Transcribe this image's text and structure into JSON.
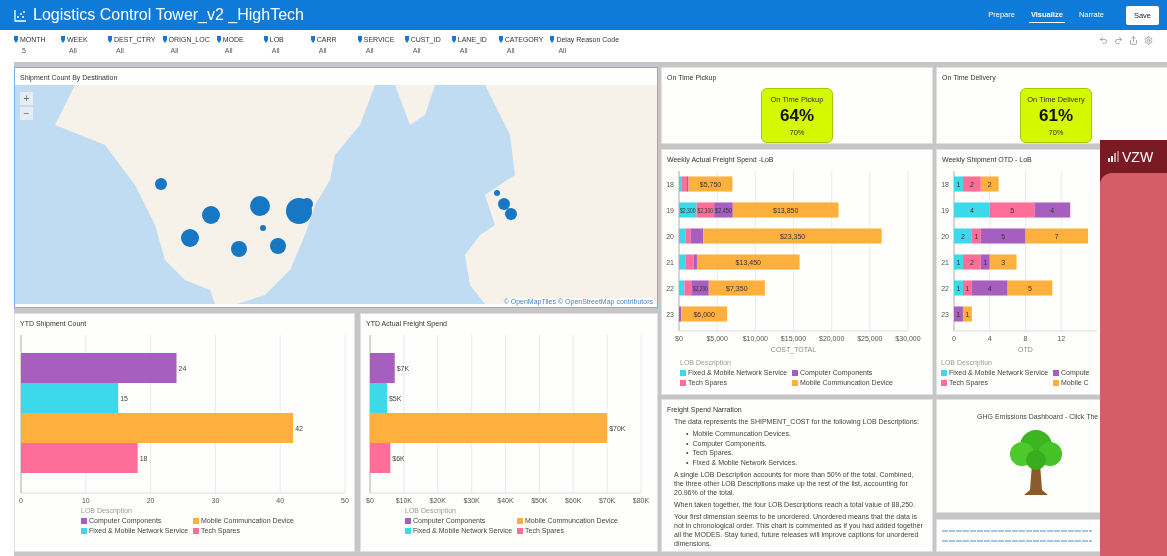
{
  "header": {
    "title": "Logistics Control Tower_v2 _HighTech",
    "tabs": [
      {
        "label": "Prepare",
        "selected": false
      },
      {
        "label": "Visualize",
        "selected": true
      },
      {
        "label": "Narrate",
        "selected": false
      }
    ],
    "save": "Save"
  },
  "filters": [
    {
      "label": "MONTH",
      "value": "5"
    },
    {
      "label": "WEEK",
      "value": "All"
    },
    {
      "label": "DEST_CTRY",
      "value": "All"
    },
    {
      "label": "ORIGN_LOC",
      "value": "All"
    },
    {
      "label": "MODE",
      "value": "All"
    },
    {
      "label": "LOB",
      "value": "All"
    },
    {
      "label": "CARR",
      "value": "All"
    },
    {
      "label": "SERVICE",
      "value": "All"
    },
    {
      "label": "CUST_ID",
      "value": "All"
    },
    {
      "label": "LANE_ID",
      "value": "All"
    },
    {
      "label": "CATEGORY",
      "value": "All"
    },
    {
      "label": "Delay Reason Code",
      "value": "All"
    }
  ],
  "map": {
    "title": "Shipment Count By Destination",
    "zoom_in": "+",
    "zoom_out": "−",
    "attribution": "© OpenMapTiles  © OpenStreetMap contributors"
  },
  "ytd_count": {
    "title": "YTD Shipment Count",
    "legend_title": "LOB Description",
    "chart_data": {
      "type": "bar",
      "orientation": "horizontal",
      "grid": true,
      "xlim": [
        0,
        50
      ],
      "xticks": [
        0,
        10,
        20,
        30,
        40,
        50
      ],
      "value_labels": [
        "24",
        "15",
        "42",
        "18"
      ],
      "series": [
        {
          "name": "Computer Components",
          "color": "#a65fbf",
          "values": [
            24,
            null,
            null,
            null
          ]
        },
        {
          "name": "Fixed & Mobile Network Service",
          "color": "#3bd9ea",
          "values": [
            null,
            15,
            null,
            null
          ]
        },
        {
          "name": "Mobile Communcation Device",
          "color": "#fdb03d",
          "values": [
            null,
            null,
            42,
            null
          ]
        },
        {
          "name": "Tech Spares",
          "color": "#fe6e98",
          "values": [
            null,
            null,
            null,
            18
          ]
        }
      ]
    }
  },
  "ytd_spend": {
    "title": "YTD Actual Freight Spend",
    "legend_title": "LOB Description",
    "chart_data": {
      "type": "bar",
      "orientation": "horizontal",
      "grid": true,
      "xlim": [
        0,
        80
      ],
      "xticks": [
        {
          "value": 0,
          "label": "$0"
        },
        {
          "value": 10,
          "label": "$10K"
        },
        {
          "value": 20,
          "label": "$20K"
        },
        {
          "value": 30,
          "label": "$30K"
        },
        {
          "value": 40,
          "label": "$40K"
        },
        {
          "value": 50,
          "label": "$50K"
        },
        {
          "value": 60,
          "label": "$60K"
        },
        {
          "value": 70,
          "label": "$70K"
        },
        {
          "value": 80,
          "label": "$80K"
        }
      ],
      "value_labels": [
        "$7K",
        "$5K",
        "$70K",
        "$6K"
      ],
      "series": [
        {
          "name": "Computer Components",
          "color": "#a65fbf",
          "values": [
            7.3,
            null,
            null,
            null
          ]
        },
        {
          "name": "Fixed & Mobile Network Service",
          "color": "#3bd9ea",
          "values": [
            null,
            5,
            null,
            null
          ]
        },
        {
          "name": "Mobile Communcation Device",
          "color": "#fdb03d",
          "values": [
            null,
            null,
            70,
            null
          ]
        },
        {
          "name": "Tech Spares",
          "color": "#fe6e98",
          "values": [
            null,
            null,
            null,
            6
          ]
        }
      ]
    }
  },
  "kpis": [
    {
      "panel_title": "On Time Pickup",
      "title": "On Time Pickup",
      "value": "64%",
      "target": "70%"
    },
    {
      "panel_title": "On Time Delivery",
      "title": "On Time Delivery",
      "value": "61%",
      "target": "70%"
    }
  ],
  "weekly_spend": {
    "title": "Weekly Actual Freight Spend -LoB",
    "legend_title": "LOB Description",
    "chart_data": {
      "type": "bar",
      "orientation": "horizontal",
      "stacked": true,
      "grid": true,
      "xlabel": "COST_TOTAL",
      "categories": [
        "18",
        "19",
        "20",
        "21",
        "22",
        "23"
      ],
      "xlim": [
        0,
        30000
      ],
      "xticks": [
        {
          "value": 0,
          "label": "$0"
        },
        {
          "value": 5000,
          "label": "$5,000"
        },
        {
          "value": 10000,
          "label": "$10,000"
        },
        {
          "value": 15000,
          "label": "$15,000"
        },
        {
          "value": 20000,
          "label": "$20,000"
        },
        {
          "value": 25000,
          "label": "$25,000"
        },
        {
          "value": 30000,
          "label": "$30,000"
        }
      ],
      "value_labels": [
        [
          null,
          "$2,300",
          null,
          null,
          null,
          null
        ],
        [
          null,
          "$2,300",
          null,
          null,
          null,
          null
        ],
        [
          null,
          "$2,450",
          null,
          null,
          "$2,200",
          null
        ],
        [
          "$5,750",
          "$13,850",
          "$23,350",
          "$13,450",
          "$7,350",
          "$6,000"
        ]
      ],
      "series": [
        {
          "name": "Fixed & Mobile Network Service",
          "color": "#3bd9ea",
          "values": [
            400,
            2300,
            850,
            900,
            700,
            null
          ]
        },
        {
          "name": "Tech Spares",
          "color": "#fe6e98",
          "values": [
            650,
            2300,
            650,
            1000,
            1000,
            null
          ]
        },
        {
          "name": "Computer Components",
          "color": "#a65fbf",
          "values": [
            200,
            2450,
            1700,
            450,
            2200,
            300
          ]
        },
        {
          "name": "Mobile Communcation Device",
          "color": "#fdb03d",
          "values": [
            5750,
            13850,
            23350,
            13450,
            7350,
            6000
          ]
        }
      ]
    }
  },
  "weekly_otd": {
    "title": "Weekly Shipment OTD - LoB",
    "legend_title": "LOB Description",
    "chart_data": {
      "type": "bar",
      "orientation": "horizontal",
      "stacked": true,
      "grid": true,
      "xlabel": "OTD",
      "categories": [
        "18",
        "19",
        "20",
        "21",
        "22",
        "23"
      ],
      "xlim": [
        0,
        16
      ],
      "xticks": [
        0,
        4,
        8,
        12
      ],
      "value_labels": [
        [
          "1",
          "4",
          "2",
          "1",
          "1",
          null
        ],
        [
          "2",
          "5",
          "1",
          "2",
          "1",
          null
        ],
        [
          null,
          "4",
          "5",
          "1",
          "4",
          "1"
        ],
        [
          "2",
          null,
          "7",
          "3",
          "5",
          "1"
        ]
      ],
      "series": [
        {
          "name": "Fixed & Mobile Network Service",
          "color": "#3bd9ea",
          "values": [
            1,
            4,
            2,
            1,
            1,
            null
          ]
        },
        {
          "name": "Tech Spares",
          "color": "#fe6e98",
          "values": [
            2,
            5,
            1,
            2,
            1,
            null
          ]
        },
        {
          "name": "Compute",
          "color": "#a65fbf",
          "values": [
            null,
            4,
            5,
            1,
            4,
            1
          ]
        },
        {
          "name": "Mobile C",
          "color": "#fdb03d",
          "values": [
            2,
            null,
            7,
            3,
            5,
            1
          ]
        }
      ]
    }
  },
  "narration": {
    "title": "Freight Spend Narration",
    "intro": "The data represents the SHIPMENT_COST for the following LOB Descriptions:",
    "bullet": "•",
    "items": [
      "Mobile Communcation Devices.",
      "Computer Components.",
      "Tech Spares.",
      "Fixed & Mobile Network Services."
    ],
    "paragraphs": [
      "A single LOB Description accounts for more than 50% of the total. Combined, the three other LOB Descriptions make up the rest of the list, accounting for 20.96% of the total.",
      "When taken together, the four LOB Descriptions reach a total value of 88,250.",
      "Your first dimension seems to be unordered. Unordered means that the data is not in chronological order. This chart is commented as if you had added together all the MODES. Stay tuned, future releases will improve captions for unordered dimensions."
    ]
  },
  "ghg": {
    "title": "GHG Emissions Dashboard - Click The"
  },
  "overlay": {
    "carrier": "VZW"
  }
}
